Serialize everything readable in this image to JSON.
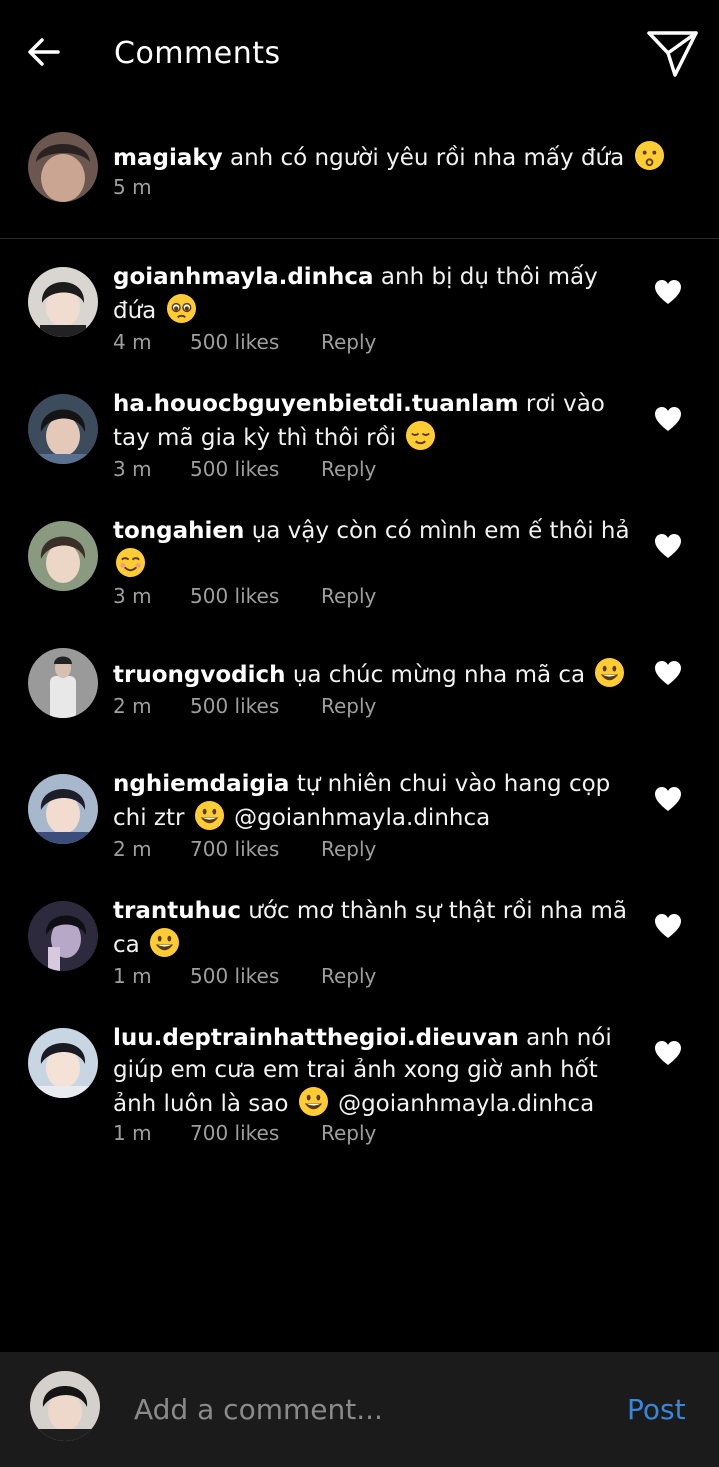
{
  "header": {
    "title": "Comments"
  },
  "caption": {
    "username": "magiaky",
    "text": "anh có người yêu rồi nha mấy đứa",
    "emoji": "kissing",
    "time": "5 m"
  },
  "comments": [
    {
      "username": "goianhmayla.dinhca",
      "text": "anh bị dụ thôi mấy đứa",
      "emoji": "pleading",
      "time": "4 m",
      "likes": "500 likes",
      "reply": "Reply"
    },
    {
      "username": "ha.houocbguyenbietdi.tuanlam",
      "text": "rơi vào tay mã gia kỳ thì thôi rồi",
      "emoji": "relieved",
      "time": "3 m",
      "likes": "500 likes",
      "reply": "Reply"
    },
    {
      "username": "tongahien",
      "text": "ụa vậy còn có mình em ế thôi hả",
      "emoji": "smiling",
      "time": "3 m",
      "likes": "500 likes",
      "reply": "Reply"
    },
    {
      "username": "truongvodich",
      "text": "ụa chúc mừng nha mã ca",
      "emoji": "grin",
      "time": "2 m",
      "likes": "500 likes",
      "reply": "Reply"
    },
    {
      "username": "nghiemdaigia",
      "text": "tự nhiên chui vào hang cọp chi ztr",
      "emoji": "grin",
      "mention": "@goianhmayla.dinhca",
      "time": "2 m",
      "likes": "700 likes",
      "reply": "Reply"
    },
    {
      "username": "trantuhuc",
      "text": "ước mơ thành sự thật rồi nha mã ca",
      "emoji": "grin",
      "time": "1 m",
      "likes": "500 likes",
      "reply": "Reply"
    },
    {
      "username": "luu.deptrainhatthegioi.dieuvan",
      "text": "anh nói giúp em cưa em trai ảnh xong giờ anh hốt ảnh luôn là sao",
      "emoji": "grin",
      "mention": "@goianhmayla.dinhca",
      "time": "1 m",
      "likes": "700 likes",
      "reply": "Reply"
    }
  ],
  "composer": {
    "placeholder": "Add a comment...",
    "post": "Post"
  },
  "colors": {
    "background": "#000000",
    "meta": "#9e9e9e",
    "composer_bg": "#1b1b1b",
    "post": "#3a86d8",
    "emoji": "#ffcc33"
  }
}
